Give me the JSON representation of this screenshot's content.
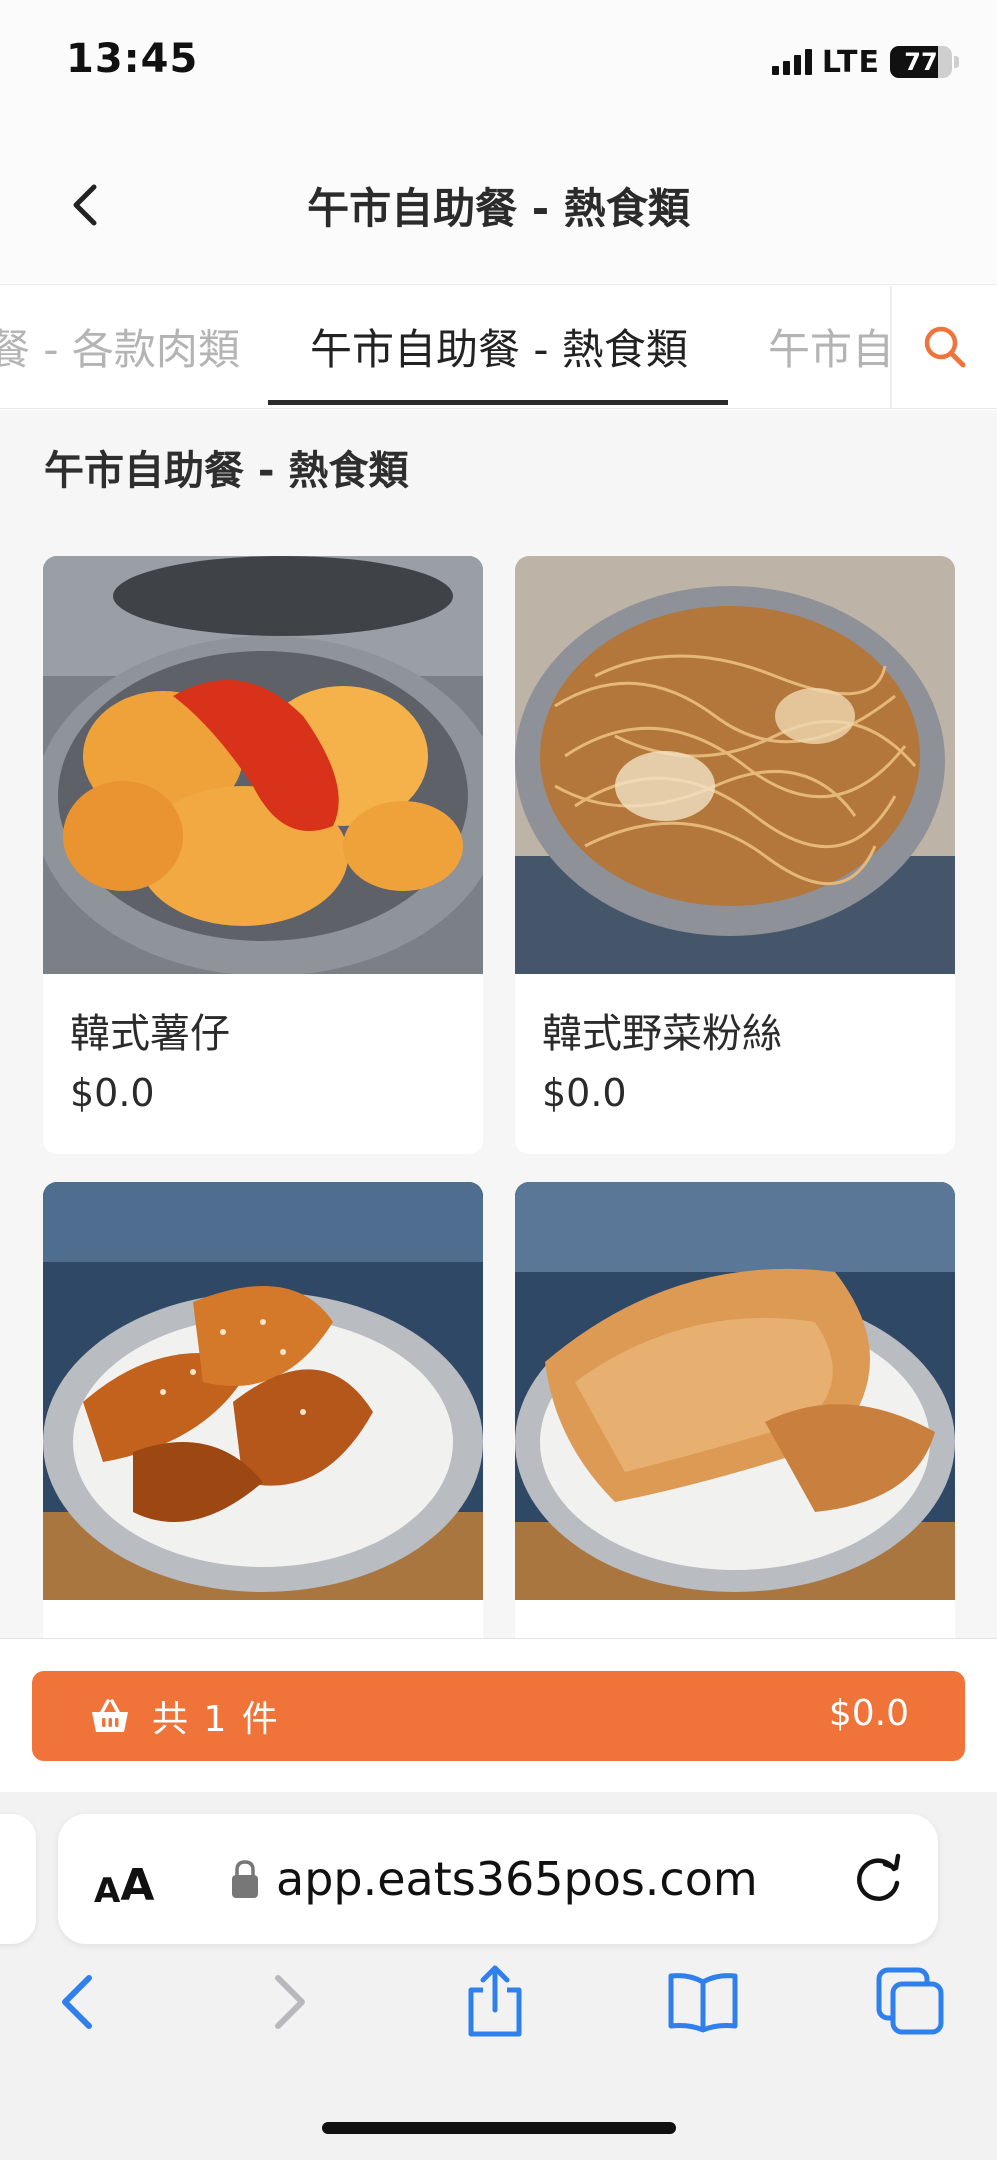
{
  "status_bar": {
    "time": "13:45",
    "network": "LTE",
    "battery": "77"
  },
  "header": {
    "title": "午市自助餐 - 熱食類"
  },
  "tabs": [
    {
      "label": "餐 - 各款肉類",
      "active": false
    },
    {
      "label": "午市自助餐 - 熱食類",
      "active": true
    },
    {
      "label": "午市自",
      "active": false
    }
  ],
  "section": {
    "title": "午市自助餐 - 熱食類"
  },
  "items": [
    {
      "name": "韓式薯仔",
      "price": "$0.0",
      "icon": "potato-dish-photo"
    },
    {
      "name": "韓式野菜粉絲",
      "price": "$0.0",
      "icon": "glass-noodle-dish-photo"
    },
    {
      "name": "",
      "price": "",
      "icon": "chicken-wing-dish-photo"
    },
    {
      "name": "",
      "price": "",
      "icon": "pancake-dish-photo"
    }
  ],
  "cart": {
    "count_label": "共 1 件",
    "total": "$0.0"
  },
  "browser": {
    "text_size_label_small": "A",
    "text_size_label_big": "A",
    "url": "app.eats365pos.com"
  },
  "colors": {
    "accent": "#f07339",
    "active_tab": "#2b2b2b",
    "ios_blue": "#2f80ed"
  }
}
